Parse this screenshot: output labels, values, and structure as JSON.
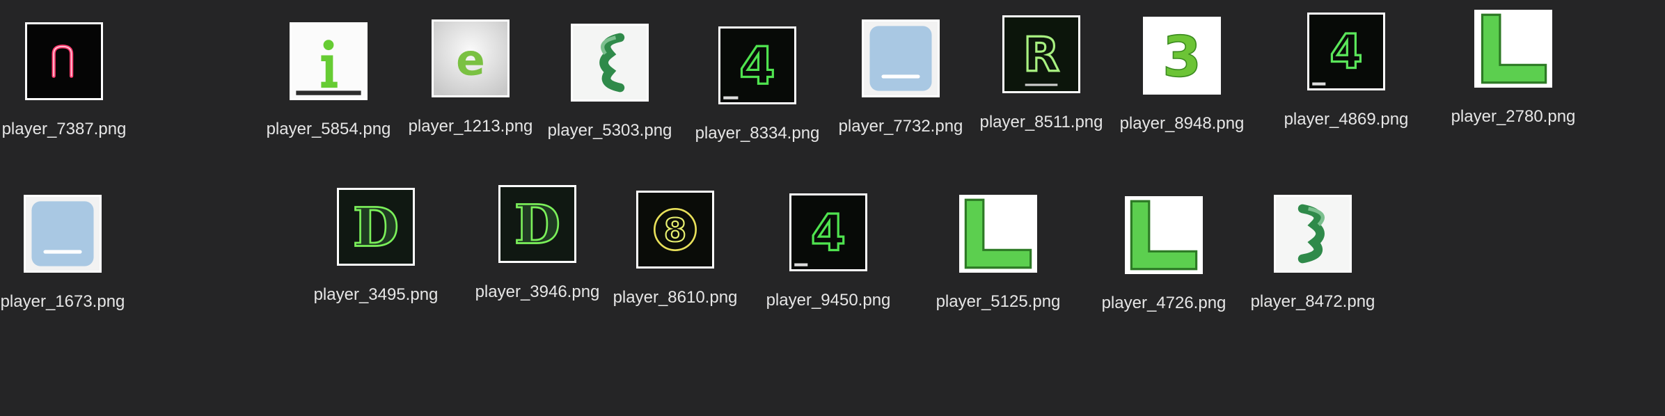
{
  "files": [
    {
      "name": "player_7387.png",
      "icon": "neon-letter-n-icon"
    },
    {
      "name": "player_5854.png",
      "icon": "letter-i-icon"
    },
    {
      "name": "player_1213.png",
      "icon": "letter-e-icon"
    },
    {
      "name": "player_5303.png",
      "icon": "letter-epsilon-icon"
    },
    {
      "name": "player_8334.png",
      "icon": "neon-digit-4-icon"
    },
    {
      "name": "player_7732.png",
      "icon": "blue-tile-icon"
    },
    {
      "name": "player_8511.png",
      "icon": "neon-letter-r-icon"
    },
    {
      "name": "player_8948.png",
      "icon": "digit-3-icon"
    },
    {
      "name": "player_4869.png",
      "icon": "neon-digit-4-icon"
    },
    {
      "name": "player_2780.png",
      "icon": "letter-l-icon"
    },
    {
      "name": "player_1673.png",
      "icon": "blue-tile-icon"
    },
    {
      "name": "player_3495.png",
      "icon": "letter-d-icon"
    },
    {
      "name": "player_3946.png",
      "icon": "letter-d-icon"
    },
    {
      "name": "player_8610.png",
      "icon": "neon-digit-8-icon"
    },
    {
      "name": "player_9450.png",
      "icon": "neon-digit-4-icon"
    },
    {
      "name": "player_5125.png",
      "icon": "letter-l-icon"
    },
    {
      "name": "player_4726.png",
      "icon": "letter-l-icon"
    },
    {
      "name": "player_8472.png",
      "icon": "digit-3-stripes-icon"
    }
  ]
}
